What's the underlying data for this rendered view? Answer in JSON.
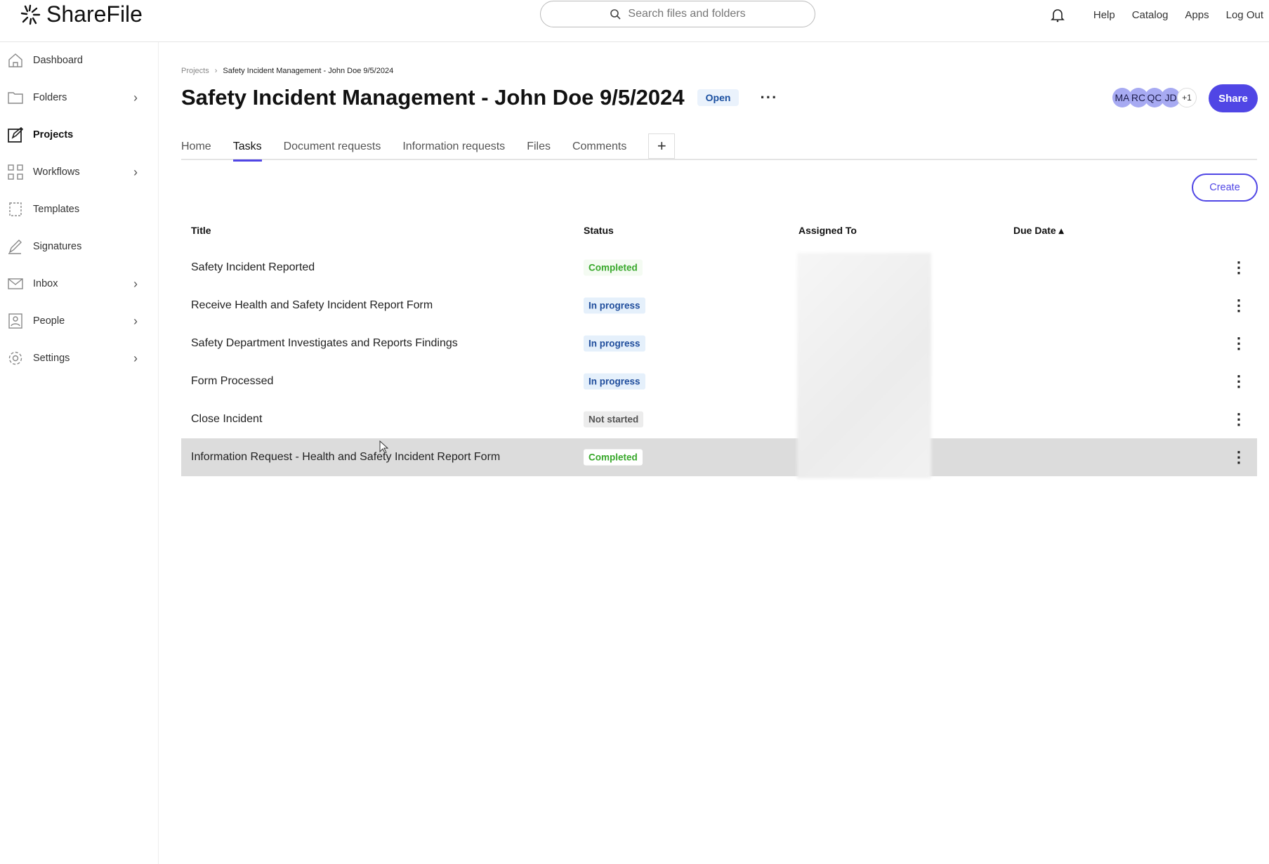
{
  "header": {
    "logo": "ShareFile",
    "search_placeholder": "Search files and folders",
    "nav": [
      "Help",
      "Catalog",
      "Apps",
      "Log Out"
    ]
  },
  "sidebar": {
    "items": [
      {
        "label": "Dashboard",
        "icon": "home-icon",
        "chevron": false
      },
      {
        "label": "Folders",
        "icon": "folder-icon",
        "chevron": true
      },
      {
        "label": "Projects",
        "icon": "projects-icon",
        "chevron": false,
        "active": true
      },
      {
        "label": "Workflows",
        "icon": "workflows-icon",
        "chevron": true
      },
      {
        "label": "Templates",
        "icon": "templates-icon",
        "chevron": false
      },
      {
        "label": "Signatures",
        "icon": "pen-icon",
        "chevron": false
      },
      {
        "label": "Inbox",
        "icon": "mail-icon",
        "chevron": true
      },
      {
        "label": "People",
        "icon": "person-icon",
        "chevron": true
      },
      {
        "label": "Settings",
        "icon": "gear-icon",
        "chevron": true
      }
    ]
  },
  "breadcrumb": {
    "root": "Projects",
    "current": "Safety Incident Management - John Doe 9/5/2024"
  },
  "project": {
    "title": "Safety Incident Management - John Doe 9/5/2024",
    "status": "Open",
    "avatars": [
      "MA",
      "RC",
      "QC",
      "JD",
      "+1"
    ],
    "share_label": "Share"
  },
  "tabs": [
    "Home",
    "Tasks",
    "Document requests",
    "Information requests",
    "Files",
    "Comments"
  ],
  "active_tab": "Tasks",
  "create_label": "Create",
  "table": {
    "columns": [
      "Title",
      "Status",
      "Assigned To",
      "Due Date ▴"
    ],
    "rows": [
      {
        "title": "Safety Incident Reported",
        "status": "Completed"
      },
      {
        "title": "Receive Health and Safety Incident Report Form",
        "status": "In progress"
      },
      {
        "title": "Safety Department Investigates and Reports Findings",
        "status": "In progress"
      },
      {
        "title": "Form Processed",
        "status": "In progress"
      },
      {
        "title": "Close Incident",
        "status": "Not started"
      },
      {
        "title": "Information Request - Health and Safety Incident Report Form",
        "status": "Completed",
        "highlighted": true
      }
    ]
  },
  "colors": {
    "accent": "#5046e5",
    "completed": "#38a82b",
    "in_progress": "#1f4d9c"
  }
}
